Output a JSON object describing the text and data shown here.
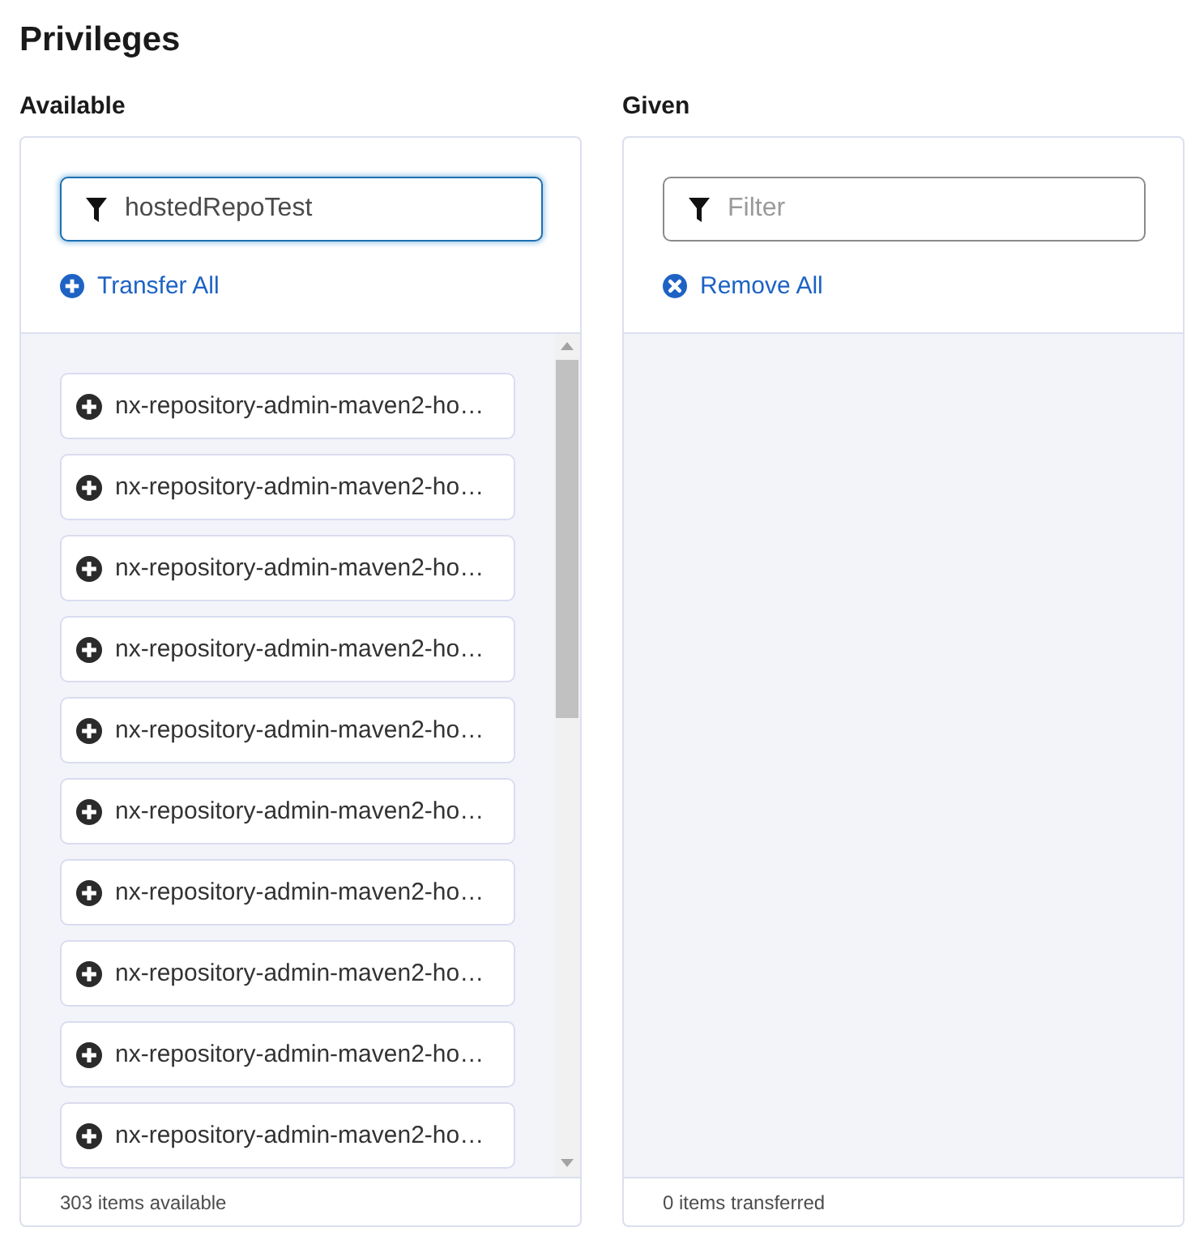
{
  "title": "Privileges",
  "available": {
    "heading": "Available",
    "filter": {
      "value": "hostedRepoTest",
      "focused": true
    },
    "action": {
      "kind": "add",
      "label": "Transfer All"
    },
    "items": [
      {
        "label": "nx-repository-admin-maven2-ho…"
      },
      {
        "label": "nx-repository-admin-maven2-ho…"
      },
      {
        "label": "nx-repository-admin-maven2-ho…"
      },
      {
        "label": "nx-repository-admin-maven2-ho…"
      },
      {
        "label": "nx-repository-admin-maven2-ho…"
      },
      {
        "label": "nx-repository-admin-maven2-ho…"
      },
      {
        "label": "nx-repository-admin-maven2-ho…"
      },
      {
        "label": "nx-repository-admin-maven2-ho…"
      },
      {
        "label": "nx-repository-admin-maven2-ho…"
      },
      {
        "label": "nx-repository-admin-maven2-ho…"
      }
    ],
    "footer": "303 items available"
  },
  "given": {
    "heading": "Given",
    "filter": {
      "placeholder": "Filter",
      "focused": false
    },
    "action": {
      "kind": "remove",
      "label": "Remove All"
    },
    "footer": "0 items transferred"
  }
}
